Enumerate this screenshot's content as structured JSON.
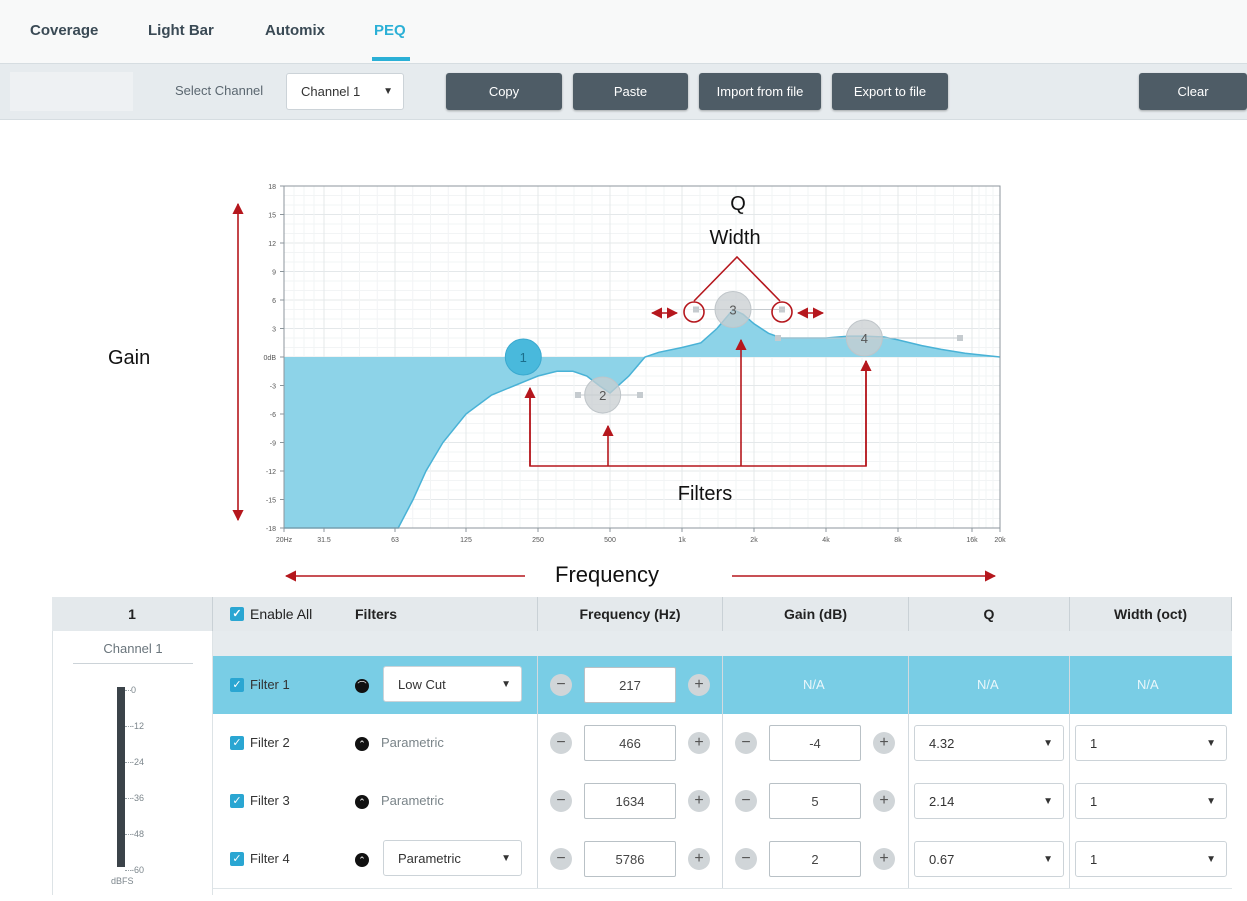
{
  "tabs": [
    {
      "label": "Coverage"
    },
    {
      "label": "Light Bar"
    },
    {
      "label": "Automix"
    },
    {
      "label": "PEQ"
    }
  ],
  "toolbar": {
    "select_label": "Select Channel",
    "channel_value": "Channel 1",
    "copy": "Copy",
    "paste": "Paste",
    "import": "Import from file",
    "export": "Export to file",
    "clear": "Clear"
  },
  "chart_data": {
    "type": "area",
    "y_ticks": [
      "18",
      "15",
      "12",
      "9",
      "6",
      "3",
      "0dB",
      "-3",
      "-6",
      "-9",
      "-12",
      "-15",
      "-18"
    ],
    "x_ticks": [
      "20Hz",
      "31.5",
      "63",
      "125",
      "250",
      "500",
      "1k",
      "2k",
      "4k",
      "8k",
      "16k",
      "20k"
    ],
    "ylim": [
      -18,
      18
    ],
    "xlim": [
      20,
      20000
    ],
    "x_scale": "log",
    "response_curve": {
      "x": [
        20,
        55,
        65,
        75,
        85,
        100,
        125,
        160,
        200,
        250,
        300,
        350,
        400,
        450,
        500,
        600,
        700,
        800,
        1000,
        1200,
        1400,
        1634,
        1800,
        2000,
        2300,
        2600,
        3000,
        3500,
        4000,
        4500,
        5000,
        5786,
        7000,
        8000,
        10000,
        12000,
        15000,
        20000
      ],
      "y": [
        -18,
        -18,
        -18,
        -15,
        -12,
        -9,
        -6,
        -4,
        -3,
        -2,
        -1.5,
        -1.5,
        -2,
        -3,
        -3.8,
        -2,
        0,
        0.5,
        1,
        1.5,
        3,
        5,
        4.5,
        3.5,
        2.5,
        2,
        2,
        2,
        2,
        2.1,
        2.2,
        2.2,
        2.1,
        1.8,
        1.2,
        0.8,
        0.4,
        0
      ]
    },
    "filter_points": [
      {
        "label": "1",
        "freq": 217,
        "gain": 0,
        "active": true
      },
      {
        "label": "2",
        "freq": 466,
        "gain": -4,
        "active": false
      },
      {
        "label": "3",
        "freq": 1634,
        "gain": 5,
        "active": false
      },
      {
        "label": "4",
        "freq": 5786,
        "gain": 2,
        "active": false
      }
    ],
    "colors": {
      "fill": "#8dd3e8",
      "line": "#49b2d6",
      "annotation": "#b5171d"
    }
  },
  "annotations": {
    "gain": "Gain",
    "q": "Q",
    "width": "Width",
    "filters": "Filters",
    "frequency": "Frequency"
  },
  "table": {
    "headers": {
      "channel_no": "1",
      "enable_all": "Enable All",
      "filters": "Filters",
      "frequency": "Frequency (Hz)",
      "gain": "Gain (dB)",
      "q": "Q",
      "width": "Width (oct)"
    },
    "channel_name": "Channel 1",
    "meter": {
      "ticks": [
        "0",
        "-12",
        "-24",
        "-36",
        "-48",
        "-60"
      ],
      "unit": "dBFS"
    },
    "rows": [
      {
        "name": "Filter 1",
        "type": "Low Cut",
        "type_select": true,
        "freq": "217",
        "gain": "N/A",
        "q": "N/A",
        "width": "N/A",
        "highlighted": true
      },
      {
        "name": "Filter 2",
        "type": "Parametric",
        "type_select": false,
        "freq": "466",
        "gain": "-4",
        "q": "4.32",
        "width": "1",
        "highlighted": false
      },
      {
        "name": "Filter 3",
        "type": "Parametric",
        "type_select": false,
        "freq": "1634",
        "gain": "5",
        "q": "2.14",
        "width": "1",
        "highlighted": false
      },
      {
        "name": "Filter 4",
        "type": "Parametric",
        "type_select": true,
        "freq": "5786",
        "gain": "2",
        "q": "0.67",
        "width": "1",
        "highlighted": false
      }
    ]
  }
}
